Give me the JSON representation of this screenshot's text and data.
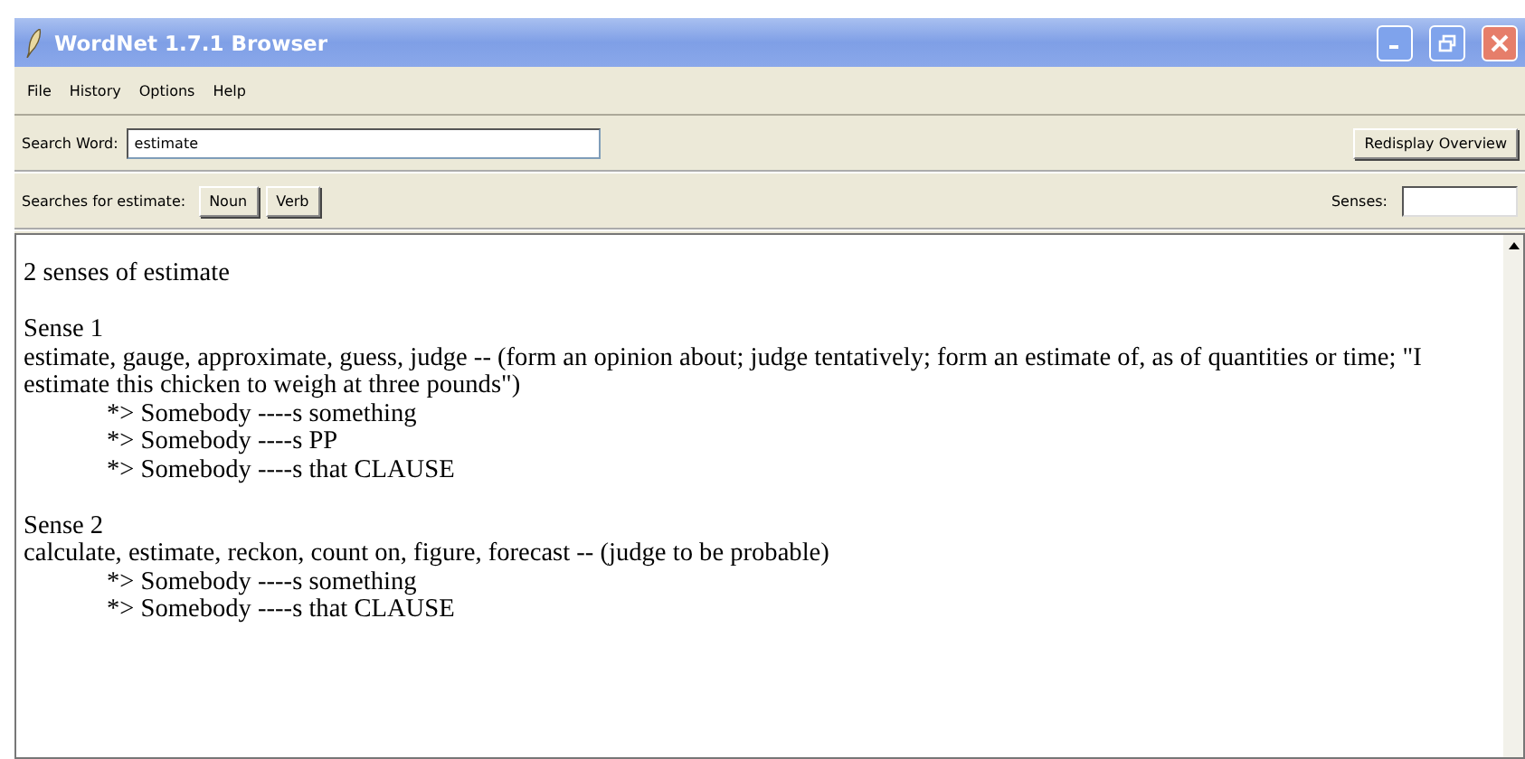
{
  "window": {
    "title": "WordNet 1.7.1 Browser"
  },
  "menu": [
    "File",
    "History",
    "Options",
    "Help"
  ],
  "search": {
    "label": "Search Word:",
    "value": "estimate",
    "button": "Redisplay Overview"
  },
  "searches": {
    "label": "Searches for estimate:",
    "buttons": [
      "Noun",
      "Verb"
    ],
    "senses_label": "Senses:"
  },
  "content": {
    "heading": "2 senses of estimate",
    "senses": [
      {
        "title": "Sense 1",
        "definition": "estimate, gauge, approximate, guess, judge -- (form an opinion about; judge tentatively; form an estimate of, as of quantities or time; \"I estimate this chicken to weigh at three pounds\")",
        "frames": [
          "*> Somebody ----s something",
          "*> Somebody ----s PP",
          "*> Somebody ----s that CLAUSE"
        ]
      },
      {
        "title": "Sense 2",
        "definition": "calculate, estimate, reckon, count on, figure, forecast -- (judge to be probable)",
        "frames": [
          "*> Somebody ----s something",
          "*> Somebody ----s that CLAUSE"
        ]
      }
    ]
  }
}
